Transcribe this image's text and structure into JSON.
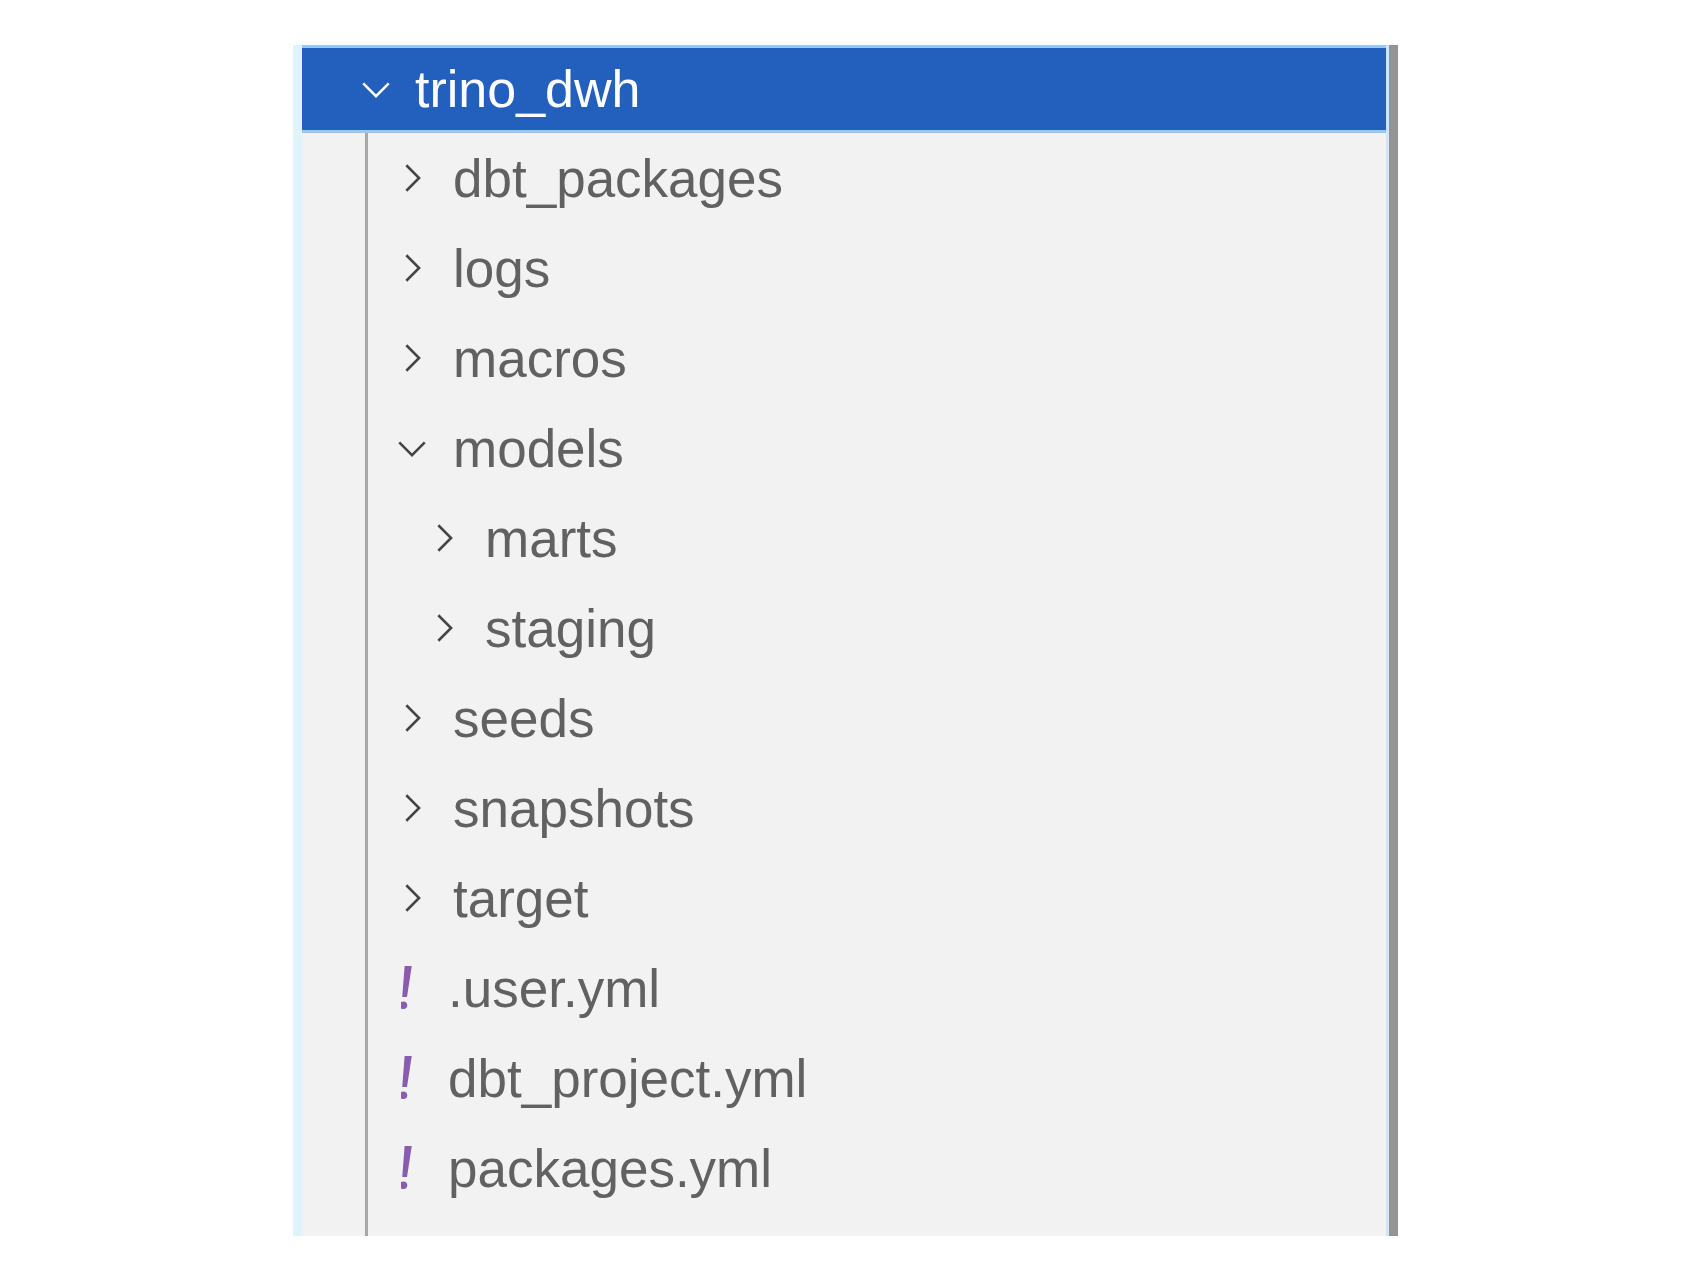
{
  "explorer": {
    "root": {
      "name": "trino_dwh",
      "expanded": true,
      "selected": true,
      "children": [
        {
          "kind": "folder",
          "name": "dbt_packages",
          "expanded": false
        },
        {
          "kind": "folder",
          "name": "logs",
          "expanded": false
        },
        {
          "kind": "folder",
          "name": "macros",
          "expanded": false
        },
        {
          "kind": "folder",
          "name": "models",
          "expanded": true,
          "children": [
            {
              "kind": "folder",
              "name": "marts",
              "expanded": false
            },
            {
              "kind": "folder",
              "name": "staging",
              "expanded": false
            }
          ]
        },
        {
          "kind": "folder",
          "name": "seeds",
          "expanded": false
        },
        {
          "kind": "folder",
          "name": "snapshots",
          "expanded": false
        },
        {
          "kind": "folder",
          "name": "target",
          "expanded": false
        },
        {
          "kind": "file",
          "name": ".user.yml"
        },
        {
          "kind": "file",
          "name": "dbt_project.yml"
        },
        {
          "kind": "file",
          "name": "packages.yml"
        }
      ]
    }
  }
}
